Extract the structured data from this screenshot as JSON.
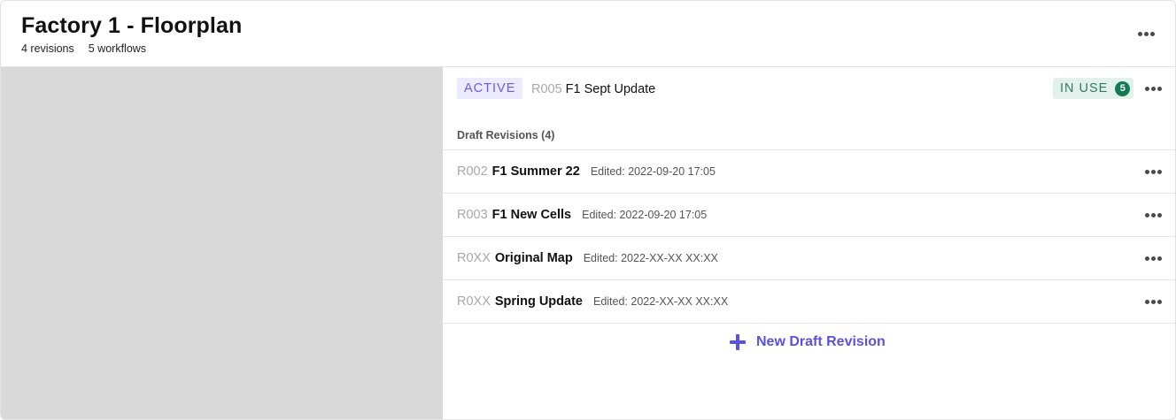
{
  "header": {
    "title": "Factory 1 - Floorplan",
    "revisions_count": "4 revisions",
    "workflows_count": "5 workflows",
    "more_icon": "more-horizontal-icon"
  },
  "active_revision": {
    "badge": "ACTIVE",
    "code": "R005",
    "name": "F1 Sept Update",
    "in_use_label": "IN USE",
    "in_use_count": "5",
    "colors": {
      "active_bg": "#ebeaff",
      "active_text": "#6b5de6",
      "in_use_bg": "#e3f1ec",
      "in_use_text": "#2f7a5f",
      "in_use_count_bg": "#137a55"
    }
  },
  "drafts": {
    "title": "Draft Revisions (4)",
    "items": [
      {
        "code": "R002",
        "name": "F1 Summer 22",
        "edited": "Edited: 2022-09-20 17:05"
      },
      {
        "code": "R003",
        "name": "F1 New Cells",
        "edited": "Edited: 2022-09-20 17:05"
      },
      {
        "code": "R0XX",
        "name": "Original Map",
        "edited": "Edited: 2022-XX-XX XX:XX"
      },
      {
        "code": "R0XX",
        "name": "Spring Update",
        "edited": "Edited: 2022-XX-XX XX:XX"
      }
    ]
  },
  "new_draft": {
    "label": "New Draft Revision",
    "icon": "plus-icon",
    "color": "#5b51e0"
  }
}
